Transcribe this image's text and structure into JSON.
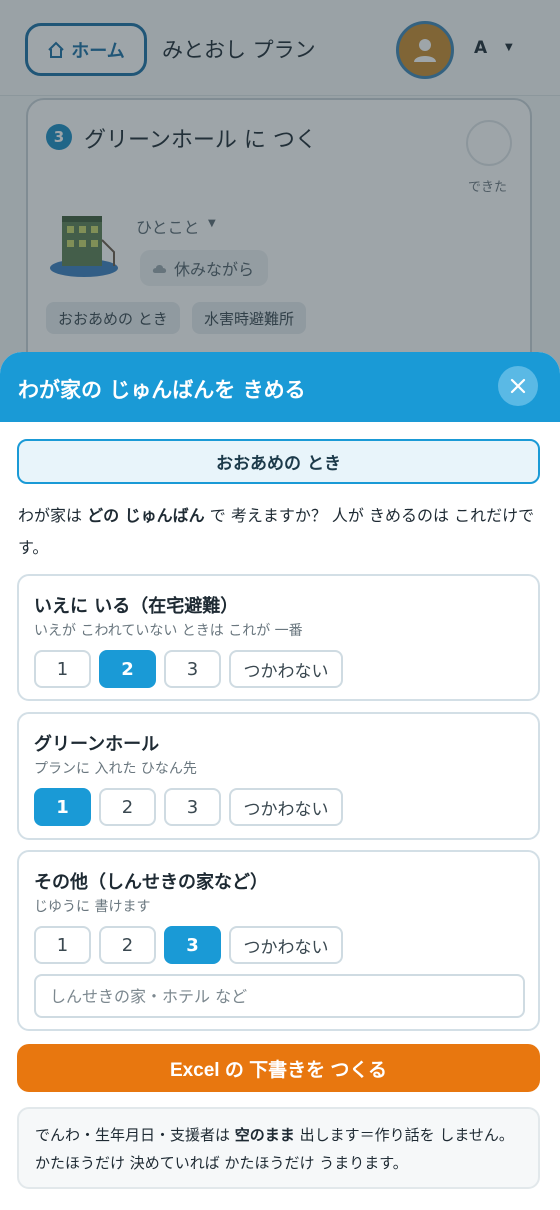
{
  "header": {
    "home_label": "ホーム",
    "app_title": "みとおし プラン",
    "lang_label": "A"
  },
  "card": {
    "step_number": "3",
    "title": "グリーンホール に つく",
    "done_label": "できた",
    "comment_label": "ひとこと",
    "rest_label": "休みながら",
    "tags": [
      "おおあめの とき",
      "水害時避難所"
    ]
  },
  "sheet": {
    "title": "わが家の じゅんばんを きめる",
    "scenario": "おおあめの とき",
    "question_pre": "わが家は ",
    "question_bold": "どの じゅんばん",
    "question_post": " で 考えますか？ 人が きめるのは これだけです。",
    "rank_none_label": "つかわない",
    "options": [
      {
        "title": "いえに いる（在宅避難）",
        "subtitle": "いえが こわれていない ときは これが 一番",
        "selected": "2"
      },
      {
        "title": "グリーンホール",
        "subtitle": "プランに 入れた ひなん先",
        "selected": "1"
      },
      {
        "title": "その他（しんせきの家など）",
        "subtitle": "じゆうに 書けます",
        "selected": "3",
        "input_placeholder": "しんせきの家・ホテル など"
      }
    ],
    "rank_numbers": [
      "1",
      "2",
      "3"
    ],
    "excel_button": "Excel の 下書きを つくる",
    "note_pre": "でんわ・生年月日・支援者は ",
    "note_bold": "空のまま",
    "note_post": " 出します＝作り話を しません。かたほうだけ 決めていれば かたほうだけ うまります。"
  },
  "colors": {
    "primary": "#1a9ad6",
    "accent_orange": "#e8770f",
    "overlay": "#283741"
  }
}
